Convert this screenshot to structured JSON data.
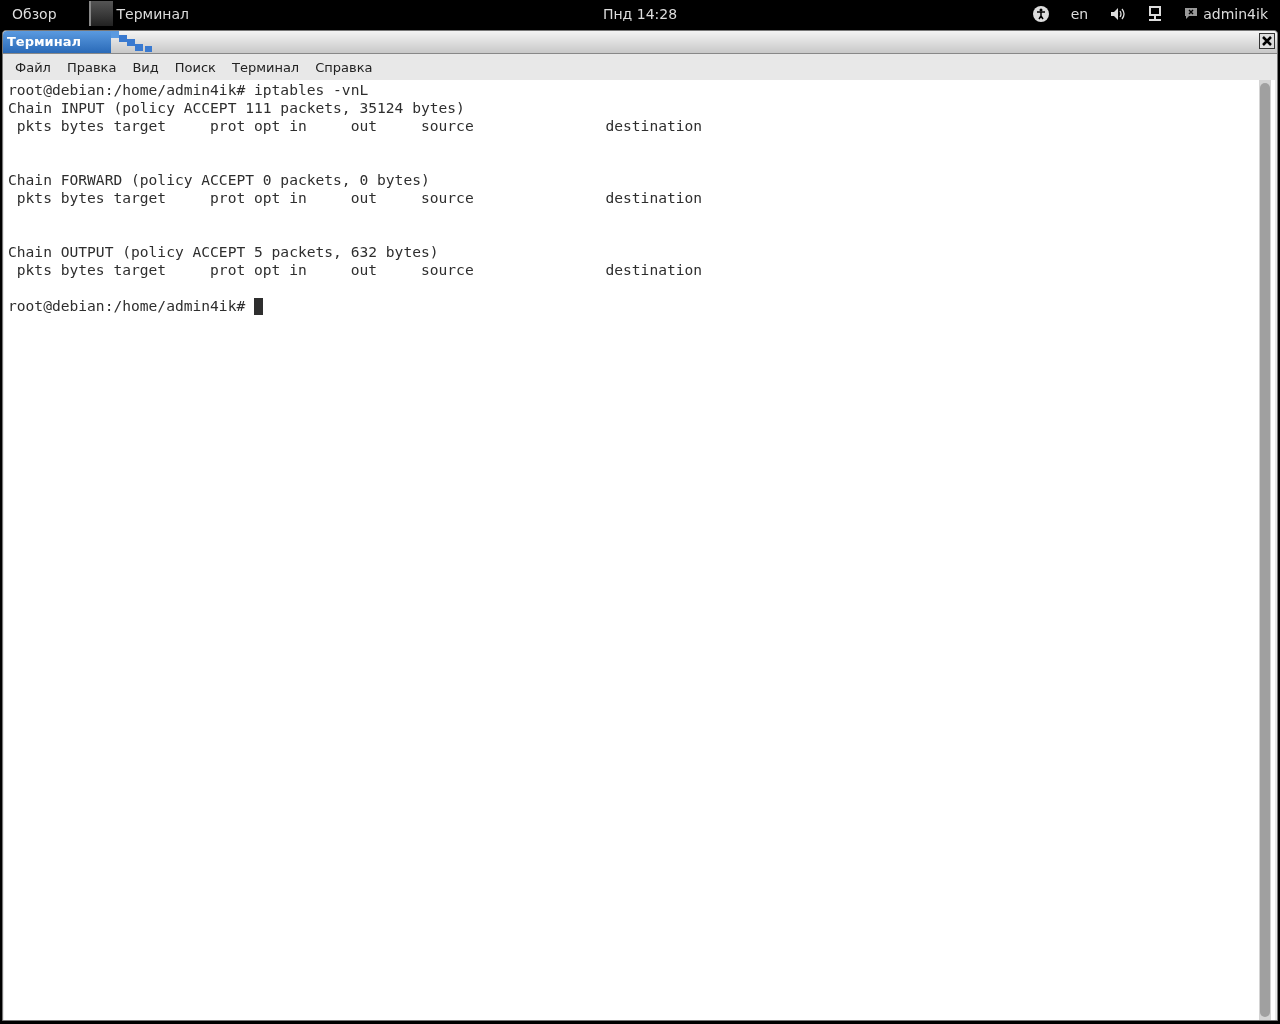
{
  "top_bar": {
    "activities": "Обзор",
    "app": "Терминал",
    "clock": "Пнд 14:28",
    "language": "en",
    "user": "admin4ik"
  },
  "window": {
    "title": "Терминал"
  },
  "menu": [
    "Файл",
    "Правка",
    "Вид",
    "Поиск",
    "Терминал",
    "Справка"
  ],
  "terminal": {
    "output": "root@debian:/home/admin4ik# iptables -vnL\nChain INPUT (policy ACCEPT 111 packets, 35124 bytes)\n pkts bytes target     prot opt in     out     source               destination\n\n\nChain FORWARD (policy ACCEPT 0 packets, 0 bytes)\n pkts bytes target     prot opt in     out     source               destination\n\n\nChain OUTPUT (policy ACCEPT 5 packets, 632 bytes)\n pkts bytes target     prot opt in     out     source               destination\n\n",
    "prompt": "root@debian:/home/admin4ik# ",
    "cursor_visible": true
  }
}
